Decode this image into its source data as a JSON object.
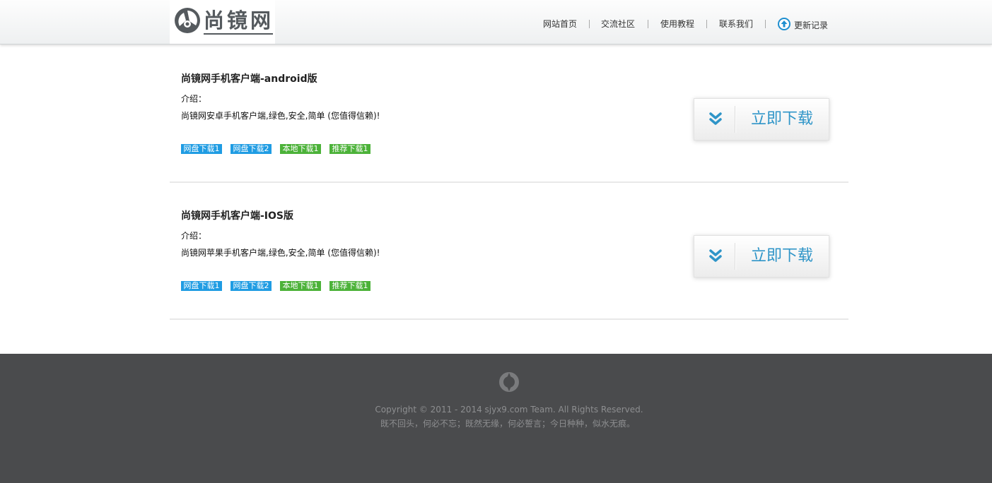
{
  "header": {
    "logo_text": "尚镜网",
    "nav": [
      {
        "label": "网站首页"
      },
      {
        "label": "交流社区"
      },
      {
        "label": "使用教程"
      },
      {
        "label": "联系我们"
      },
      {
        "label": "更新记录"
      }
    ]
  },
  "sections": [
    {
      "title": "尚镜网手机客户端-android版",
      "intro_label": "介绍：",
      "description": "尚镜网安卓手机客户端,绿色,安全,简单 (您值得信赖)!",
      "links": [
        "网盘下载1",
        "网盘下载2",
        "本地下载1",
        "推荐下载1"
      ],
      "download_label": "立即下载"
    },
    {
      "title": "尚镜网手机客户端-IOS版",
      "intro_label": "介绍：",
      "description": "尚镜网苹果手机客户端,绿色,安全,简单 (您值得信赖)!",
      "links": [
        "网盘下载1",
        "网盘下载2",
        "本地下载1",
        "推荐下载1"
      ],
      "download_label": "立即下载"
    }
  ],
  "footer": {
    "copyright": "Copyright © 2011 - 2014 sjyx9.com Team. All Rights Reserved.",
    "motto": "既不回头，何必不忘；既然无缘，何必誓言；今日种种，似水无痕。"
  },
  "colors": {
    "link_blue": "#1f9ce3",
    "link_green": "#4cb239",
    "download_text": "#2f95c8",
    "footer_bg": "#4a4b4d"
  },
  "icons": {
    "logo": "logo-mark-icon",
    "update": "arrow-up-circle-icon",
    "download": "double-chevron-down-icon",
    "footer": "ring-logo-icon"
  }
}
